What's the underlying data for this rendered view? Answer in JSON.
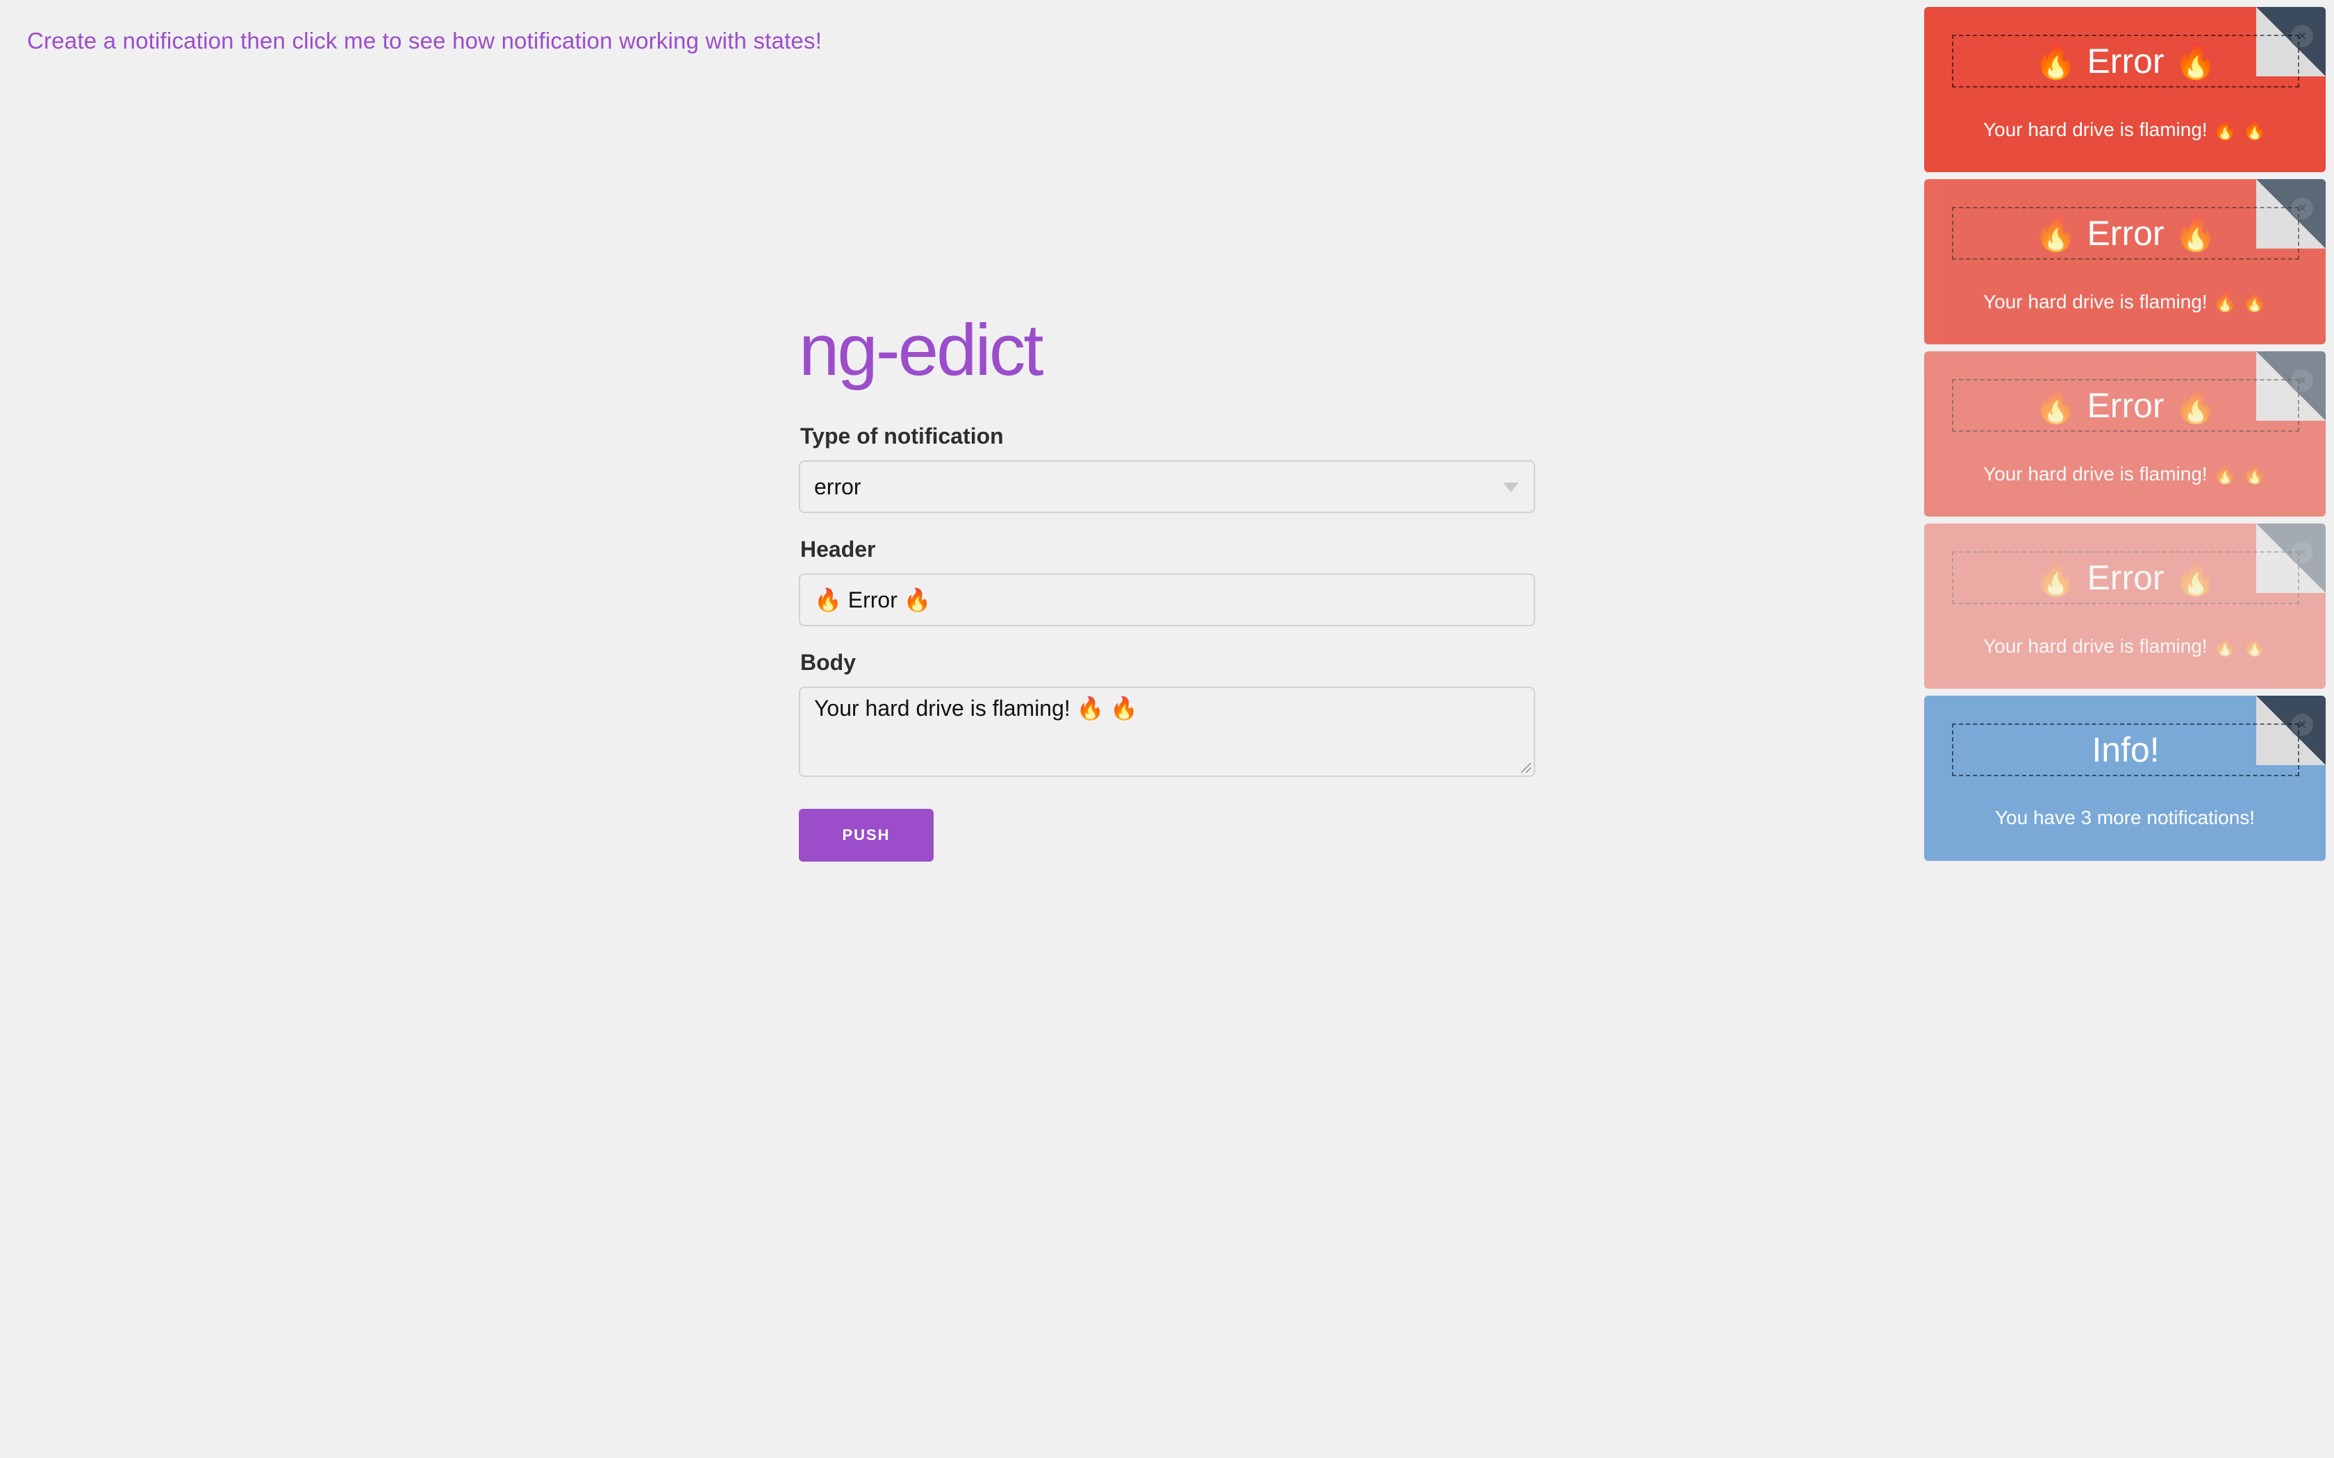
{
  "page": {
    "state_link_text": "Create a notification then click me to see how notification working with states!"
  },
  "form": {
    "title": "ng-edict",
    "type_label": "Type of notification",
    "type_value": "error",
    "header_label": "Header",
    "header_value": "🔥 Error 🔥",
    "body_label": "Body",
    "body_value": "Your hard drive is flaming! 🔥 🔥",
    "push_label": "PUSH"
  },
  "notifications": [
    {
      "type": "error",
      "header": "🔥 Error 🔥",
      "body": "Your hard drive is flaming! 🔥 🔥",
      "close": "×"
    },
    {
      "type": "error",
      "header": "🔥 Error 🔥",
      "body": "Your hard drive is flaming! 🔥 🔥",
      "close": "×"
    },
    {
      "type": "error",
      "header": "🔥 Error 🔥",
      "body": "Your hard drive is flaming! 🔥 🔥",
      "close": "×"
    },
    {
      "type": "error",
      "header": "🔥 Error 🔥",
      "body": "Your hard drive is flaming! 🔥 🔥",
      "close": "×"
    },
    {
      "type": "info",
      "header": "Info!",
      "body": "You have 3 more notifications!",
      "close": "×"
    }
  ],
  "colors": {
    "accent": "#9b4dca",
    "error": "#e74c3c",
    "info": "#7aa9d8",
    "background": "#f0f0f0"
  },
  "icons": {
    "close": "close-icon",
    "select_arrow": "chevron-down-icon",
    "fire": "fire-icon"
  }
}
